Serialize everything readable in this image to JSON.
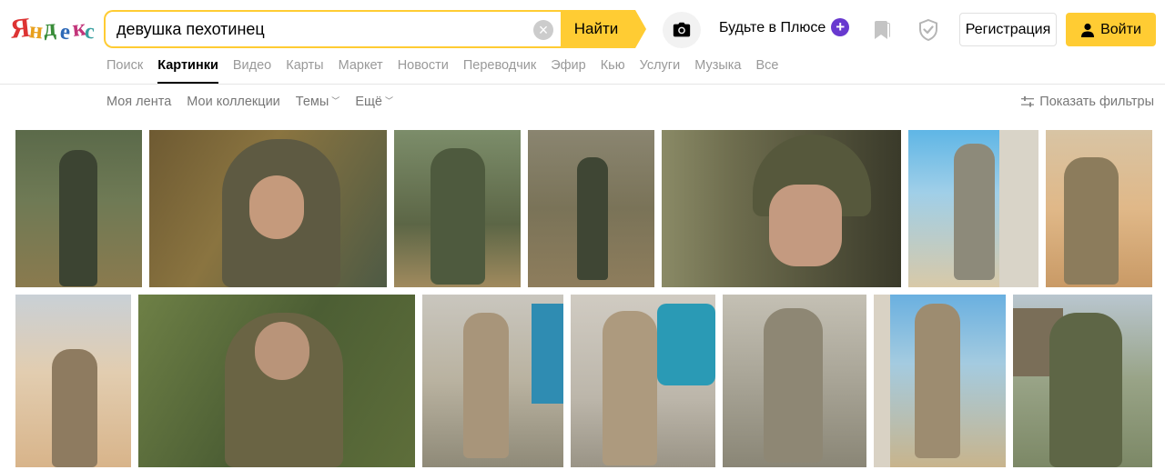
{
  "header": {
    "logo_text": "Яндекс",
    "search": {
      "value": "девушка пехотинец",
      "find_label": "Найти"
    },
    "plus_label": "Будьте в Плюсе",
    "register_label": "Регистрация",
    "login_label": "Войти"
  },
  "services": [
    {
      "label": "Поиск",
      "active": false
    },
    {
      "label": "Картинки",
      "active": true
    },
    {
      "label": "Видео",
      "active": false
    },
    {
      "label": "Карты",
      "active": false
    },
    {
      "label": "Маркет",
      "active": false
    },
    {
      "label": "Новости",
      "active": false
    },
    {
      "label": "Переводчик",
      "active": false
    },
    {
      "label": "Эфир",
      "active": false
    },
    {
      "label": "Кью",
      "active": false
    },
    {
      "label": "Услуги",
      "active": false
    },
    {
      "label": "Музыка",
      "active": false
    },
    {
      "label": "Все",
      "active": false
    }
  ],
  "subnav": {
    "feed": "Моя лента",
    "collections": "Мои коллекции",
    "themes": "Темы",
    "more": "Ещё",
    "filters": "Показать фильтры"
  },
  "colors": {
    "accent": "#ffcc33",
    "plus_purple": "#6839cf",
    "plus_orange": "#ff9d00",
    "muted_text": "#999999"
  }
}
